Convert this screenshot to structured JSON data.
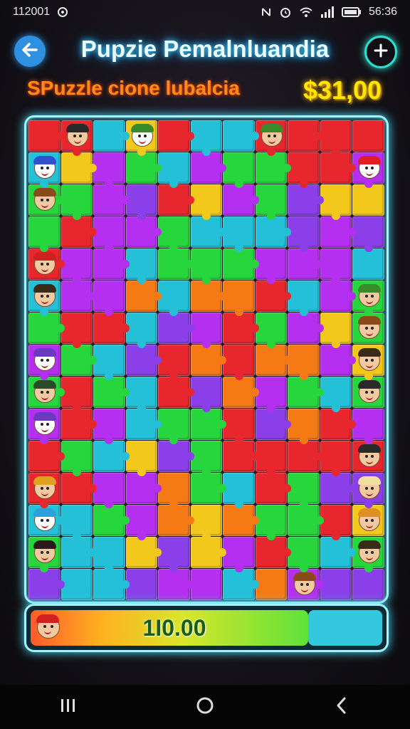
{
  "status_bar": {
    "time_left": "112001",
    "time_right": "56:36"
  },
  "header": {
    "title": "Pupzie Pemalnluandia",
    "subtitle": "SPuzzle cione lubalcia",
    "money": "$31,00",
    "back_icon": "arrow-left-icon",
    "add_icon": "plus-circle-icon"
  },
  "board": {
    "columns": 11,
    "rows": 15,
    "palette": [
      "#e8262e",
      "#27d63c",
      "#b52ff0",
      "#f57a16",
      "#23c0d8",
      "#f2c81c",
      "#ff2aa0",
      "#8a3fe8"
    ],
    "tiles": [
      "r",
      "r",
      "b",
      "y",
      "r",
      "t",
      "t",
      "r",
      "r",
      "r",
      "r",
      "b",
      "y",
      "m",
      "g",
      "t",
      "m",
      "g",
      "g",
      "r",
      "r",
      "m",
      "g",
      "g",
      "m",
      "p",
      "r",
      "y",
      "m",
      "g",
      "p",
      "y",
      "y",
      "g",
      "r",
      "m",
      "m",
      "g",
      "b",
      "t",
      "t",
      "p",
      "m",
      "p",
      "r",
      "m",
      "m",
      "t",
      "g",
      "g",
      "g",
      "m",
      "m",
      "m",
      "t",
      "t",
      "m",
      "m",
      "o",
      "t",
      "o",
      "o",
      "r",
      "t",
      "m",
      "g",
      "g",
      "r",
      "r",
      "t",
      "p",
      "m",
      "r",
      "g",
      "m",
      "y",
      "g",
      "m",
      "g",
      "t",
      "p",
      "r",
      "o",
      "r",
      "o",
      "o",
      "m",
      "y",
      "g",
      "r",
      "g",
      "t",
      "r",
      "p",
      "o",
      "m",
      "g",
      "t",
      "g",
      "m",
      "r",
      "m",
      "t",
      "g",
      "g",
      "r",
      "p",
      "o",
      "r",
      "m",
      "r",
      "g",
      "b",
      "y",
      "p",
      "g",
      "r",
      "r",
      "r",
      "r",
      "r",
      "r",
      "r",
      "m",
      "m",
      "o",
      "g",
      "b",
      "r",
      "g",
      "p",
      "p",
      "t",
      "t",
      "g",
      "m",
      "o",
      "y",
      "o",
      "g",
      "g",
      "r",
      "y",
      "g",
      "b",
      "t",
      "y",
      "p",
      "y",
      "m",
      "r",
      "g",
      "t",
      "g",
      "p",
      "t",
      "t",
      "p",
      "m",
      "m",
      "t",
      "o",
      "m",
      "p",
      "p"
    ],
    "avatars": [
      {
        "row": 0,
        "col": 1,
        "hair": "#2a2a2a",
        "bg": "#5aa0ff"
      },
      {
        "row": 0,
        "col": 3,
        "hair": "#3a8a2a",
        "bg": "#ffffff"
      },
      {
        "row": 0,
        "col": 7,
        "hair": "#3a8a2a",
        "bg": "#ffe0c0"
      },
      {
        "row": 1,
        "col": 0,
        "hair": "#3050d0",
        "bg": "#ffffff"
      },
      {
        "row": 1,
        "col": 10,
        "hair": "#e02020",
        "bg": "#ffffff"
      },
      {
        "row": 2,
        "col": 0,
        "hair": "#8a4a1a",
        "bg": "#f2c9a0"
      },
      {
        "row": 4,
        "col": 0,
        "hair": "#d02020",
        "bg": "#f2c9a0"
      },
      {
        "row": 5,
        "col": 0,
        "hair": "#3a2a1a",
        "bg": "#f2c9a0"
      },
      {
        "row": 5,
        "col": 10,
        "hair": "#3a8a2a",
        "bg": "#7ad060"
      },
      {
        "row": 6,
        "col": 10,
        "hair": "#8a4a1a",
        "bg": "#f2c9a0"
      },
      {
        "row": 7,
        "col": 0,
        "hair": "#6a3ac0",
        "bg": "#ffffff"
      },
      {
        "row": 7,
        "col": 10,
        "hair": "#3a2a1a",
        "bg": "#f2c9a0"
      },
      {
        "row": 8,
        "col": 0,
        "hair": "#2a4a2a",
        "bg": "#f2c9a0"
      },
      {
        "row": 8,
        "col": 10,
        "hair": "#2a2a2a",
        "bg": "#f2c9a0"
      },
      {
        "row": 9,
        "col": 0,
        "hair": "#6a3ac0",
        "bg": "#ffffff"
      },
      {
        "row": 10,
        "col": 10,
        "hair": "#2a2a2a",
        "bg": "#f2c9a0"
      },
      {
        "row": 11,
        "col": 0,
        "hair": "#e0a020",
        "bg": "#f2c9a0"
      },
      {
        "row": 11,
        "col": 10,
        "hair": "#f0e0a0",
        "bg": "#f2c9a0"
      },
      {
        "row": 12,
        "col": 0,
        "hair": "#2aa0e0",
        "bg": "#ffffff"
      },
      {
        "row": 12,
        "col": 10,
        "hair": "#e09020",
        "bg": "#f2c9a0"
      },
      {
        "row": 13,
        "col": 0,
        "hair": "#2a1a1a",
        "bg": "#f2c9a0"
      },
      {
        "row": 13,
        "col": 10,
        "hair": "#3a2a1a",
        "bg": "#f2c9a0"
      },
      {
        "row": 14,
        "col": 8,
        "hair": "#8a4a1a",
        "bg": "#f2c9a0"
      }
    ]
  },
  "progress": {
    "label": "1I0.00",
    "fraction": 0.8
  },
  "nav": {
    "recents_icon": "recents-icon",
    "home_icon": "home-icon",
    "back_icon": "back-icon"
  }
}
